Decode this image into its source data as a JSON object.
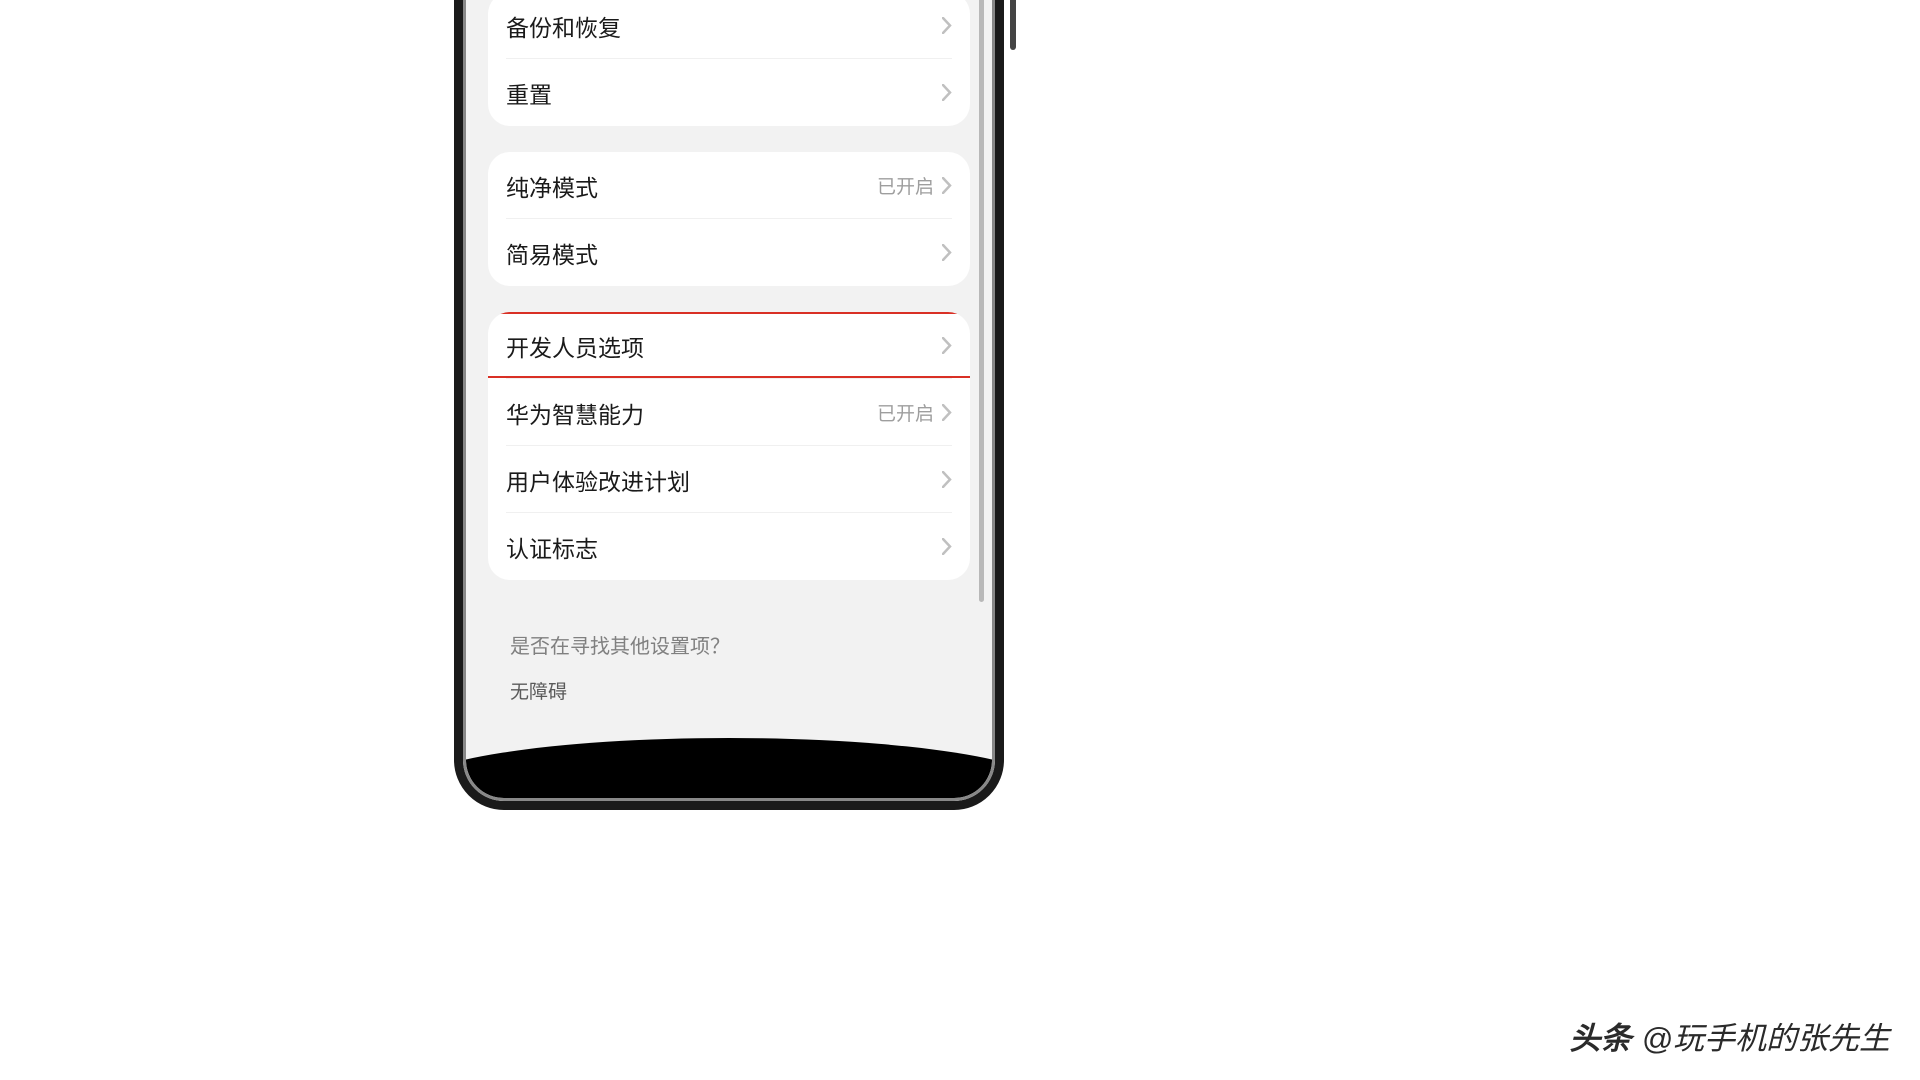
{
  "settings": {
    "group1": [
      {
        "label": "备份和恢复",
        "status": null
      },
      {
        "label": "重置",
        "status": null
      }
    ],
    "group2": [
      {
        "label": "纯净模式",
        "status": "已开启"
      },
      {
        "label": "简易模式",
        "status": null
      }
    ],
    "group3": [
      {
        "label": "开发人员选项",
        "status": null,
        "highlighted": true
      },
      {
        "label": "华为智慧能力",
        "status": "已开启"
      },
      {
        "label": "用户体验改进计划",
        "status": null
      },
      {
        "label": "认证标志",
        "status": null
      }
    ]
  },
  "footer": {
    "prompt": "是否在寻找其他设置项？",
    "link": "无障碍"
  },
  "watermark": {
    "brand": "头条",
    "handle": "@玩手机的张先生"
  }
}
